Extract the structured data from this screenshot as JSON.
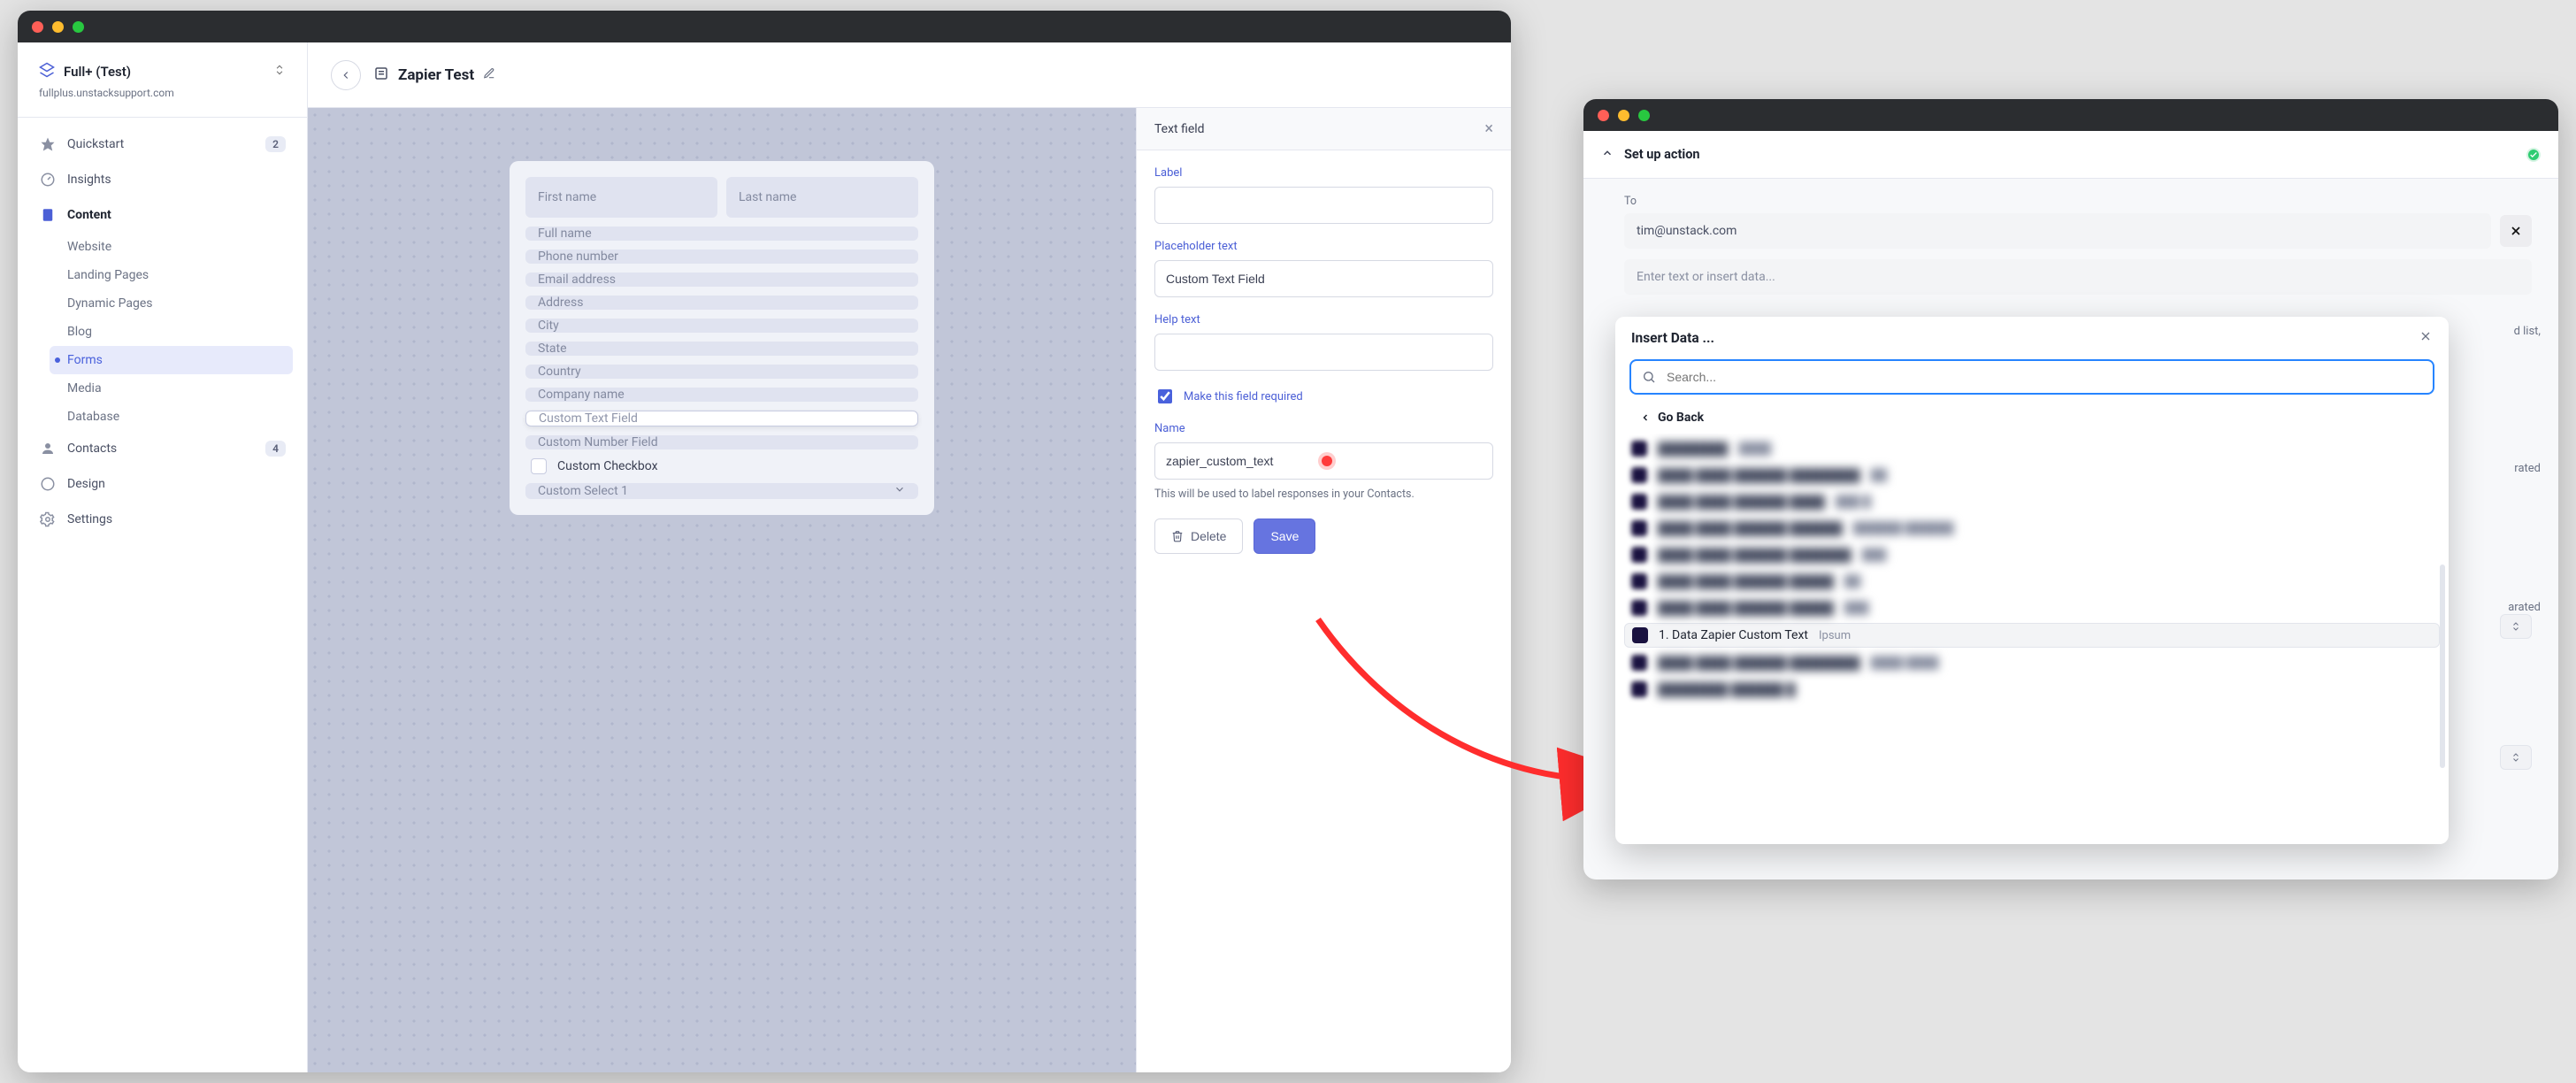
{
  "site": {
    "name": "Full+ (Test)",
    "domain": "fullplus.unstacksupport.com"
  },
  "sidebar": {
    "quickstart": {
      "label": "Quickstart",
      "badge": "2"
    },
    "insights": {
      "label": "Insights"
    },
    "content": {
      "label": "Content"
    },
    "contacts": {
      "label": "Contacts",
      "badge": "4"
    },
    "design": {
      "label": "Design"
    },
    "settings": {
      "label": "Settings"
    },
    "content_children": {
      "website": "Website",
      "landing_pages": "Landing Pages",
      "dynamic_pages": "Dynamic Pages",
      "blog": "Blog",
      "forms": "Forms",
      "media": "Media",
      "database": "Database"
    }
  },
  "page": {
    "title": "Zapier Test"
  },
  "form_fields": {
    "first_name": "First name",
    "last_name": "Last name",
    "full_name": "Full name",
    "phone": "Phone number",
    "email": "Email address",
    "address": "Address",
    "city": "City",
    "state": "State",
    "country": "Country",
    "company": "Company name",
    "custom_text": "Custom Text Field",
    "custom_number": "Custom Number Field",
    "custom_checkbox": "Custom Checkbox",
    "custom_select": "Custom Select 1"
  },
  "side_panel": {
    "header": "Text field",
    "label_title": "Label",
    "placeholder_title": "Placeholder text",
    "placeholder_value": "Custom Text Field",
    "help_title": "Help text",
    "required_label": "Make this field required",
    "required_checked": true,
    "name_title": "Name",
    "name_value": "zapier_custom_text",
    "name_hint": "This will be used to label responses in your Contacts.",
    "delete_label": "Delete",
    "save_label": "Save"
  },
  "zapier": {
    "header_title": "Set up action",
    "to_label": "To",
    "to_value": "tim@unstack.com",
    "body_placeholder": "Enter text or insert data...",
    "popover": {
      "title": "Insert Data ...",
      "search_placeholder": "Search...",
      "go_back": "Go Back",
      "highlight_label": "1. Data Zapier Custom Text",
      "highlight_value": "Ipsum"
    },
    "behind": {
      "line1": "d list,",
      "line2": "",
      "line3": "rated",
      "line4": "arated"
    }
  }
}
